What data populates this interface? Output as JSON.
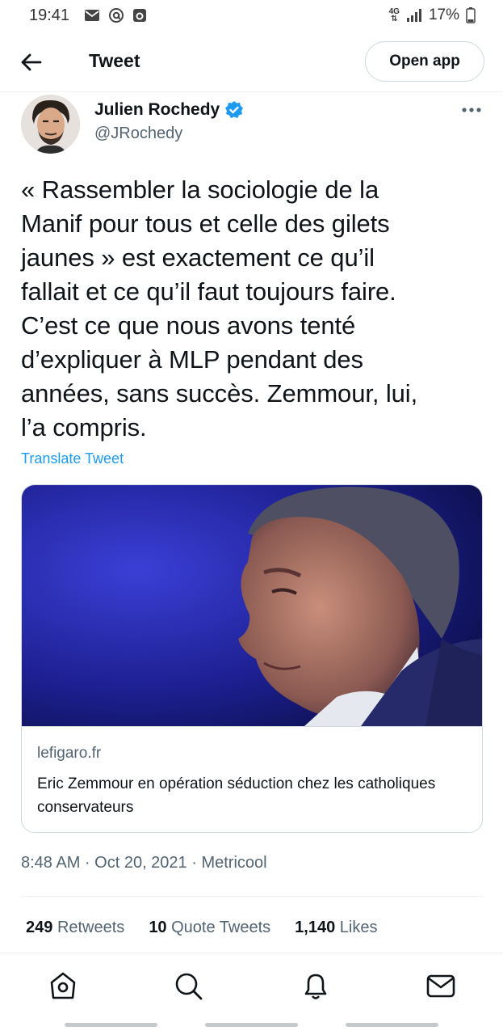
{
  "status_bar": {
    "time": "19:41",
    "network": "4G",
    "battery": "17%",
    "left_icons": [
      "mail-icon",
      "at-icon",
      "app-icon"
    ],
    "right_icons": [
      "signal-icon",
      "battery-icon"
    ]
  },
  "header": {
    "title": "Tweet",
    "open_app_label": "Open app"
  },
  "author": {
    "name": "Julien Rochedy",
    "handle": "@JRochedy",
    "verified": true
  },
  "tweet": {
    "lines": [
      "« Rassembler la sociologie de la",
      "Manif pour tous et celle des gilets",
      "jaunes » est exactement ce qu’il",
      "fallait et ce qu’il faut toujours faire.",
      "C’est ce que nous avons tenté",
      "d’expliquer à MLP pendant des",
      "années, sans succès. Zemmour, lui,",
      "l’a compris."
    ],
    "translate_label": "Translate Tweet"
  },
  "card": {
    "domain": "lefigaro.fr",
    "title": "Eric Zemmour en opération séduction chez les catholiques conservateurs"
  },
  "meta": {
    "timestamp": "8:48 AM · Oct 20, 2021 · Metricool"
  },
  "stats": {
    "retweets_count": "249",
    "retweets_label": "Retweets",
    "quotes_count": "10",
    "quotes_label": "Quote Tweets",
    "likes_count": "1,140",
    "likes_label": "Likes"
  },
  "bottom_nav": [
    "home-icon",
    "search-icon",
    "notifications-icon",
    "messages-icon"
  ],
  "colors": {
    "accent": "#1d9bf0",
    "text": "#0f1419",
    "secondary": "#536471",
    "border": "#cfd9de"
  }
}
